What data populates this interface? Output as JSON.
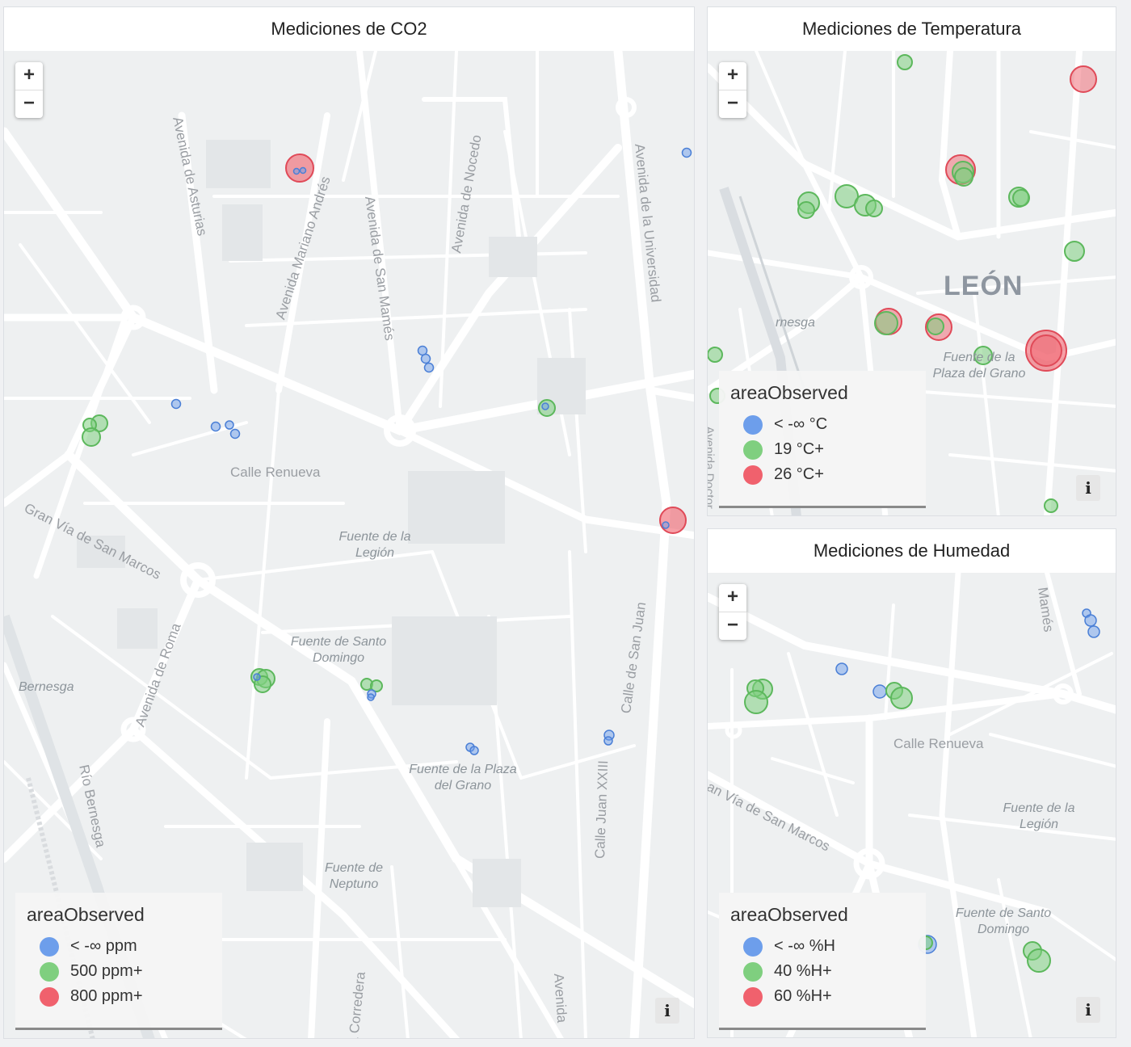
{
  "panels": {
    "co2": {
      "title": "Mediciones de CO2",
      "zoom_in": "+",
      "zoom_out": "−",
      "info": "i",
      "legend": {
        "title": "areaObserved",
        "items": [
          {
            "label": "< -∞ ppm",
            "color": "#6d9eeb"
          },
          {
            "label": "500 ppm+",
            "color": "#7fcf7f"
          },
          {
            "label": "800 ppm+",
            "color": "#f0616d"
          }
        ]
      },
      "streets": [
        "Avenida de Asturias",
        "Avenida Mariano Andrés",
        "Avenida de San Mamés",
        "Avenida de Nocedo",
        "Avenida de la Universidad",
        "Calle Renueva",
        "Gran Vía de San Marcos",
        "Avenida de Roma",
        "Calle de San Juan",
        "Calle Juan XXIII",
        "Río Bernesga",
        "la Corredera",
        "Avenida"
      ],
      "places": [
        "Fuente de la Legión",
        "Fuente de Santo Domingo",
        "Fuente de la Plaza del Grano",
        "Fuente de Neptuno",
        "Bernesga"
      ]
    },
    "temp": {
      "title": "Mediciones de Temperatura",
      "zoom_in": "+",
      "zoom_out": "−",
      "info": "i",
      "legend": {
        "title": "areaObserved",
        "items": [
          {
            "label": "< -∞ °C",
            "color": "#6d9eeb"
          },
          {
            "label": "19 °C+",
            "color": "#7fcf7f"
          },
          {
            "label": "26 °C+",
            "color": "#f0616d"
          }
        ]
      },
      "city": "LEÓN",
      "places": [
        "Fuente de la Plaza del Grano",
        "rnesga"
      ],
      "streets": [
        "Avenida Doctor"
      ]
    },
    "hum": {
      "title": "Mediciones de Humedad",
      "zoom_in": "+",
      "zoom_out": "−",
      "info": "i",
      "legend": {
        "title": "areaObserved",
        "items": [
          {
            "label": "< -∞ %H",
            "color": "#6d9eeb"
          },
          {
            "label": "40 %H+",
            "color": "#7fcf7f"
          },
          {
            "label": "60 %H+",
            "color": "#f0616d"
          }
        ]
      },
      "streets": [
        "Calle Renueva",
        "an Vía de San Marcos",
        "Mamés"
      ],
      "places": [
        "Fuente de la Legión",
        "Fuente de Santo Domingo"
      ]
    }
  }
}
